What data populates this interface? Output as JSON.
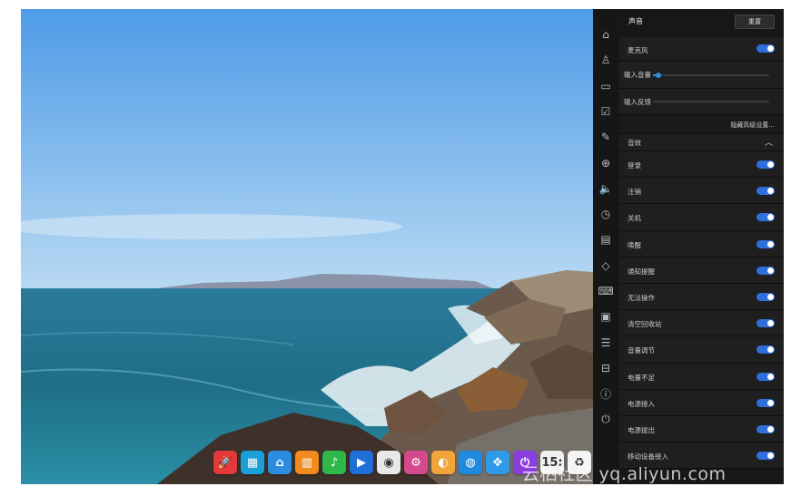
{
  "control_center": {
    "title": "声音",
    "reset_label": "重置",
    "microphone": {
      "label": "麦克风",
      "enabled": true
    },
    "input_volume": {
      "label": "输入音量",
      "level": 0.05
    },
    "input_feedback": {
      "label": "输入反馈",
      "level": 0.0
    },
    "advanced_link": "隐藏高级设置...",
    "effects_section": {
      "label": "音效",
      "expanded": true
    },
    "effects": [
      {
        "label": "登录",
        "enabled": true
      },
      {
        "label": "注销",
        "enabled": true
      },
      {
        "label": "关机",
        "enabled": true
      },
      {
        "label": "唤醒",
        "enabled": true
      },
      {
        "label": "通知提醒",
        "enabled": true
      },
      {
        "label": "无法操作",
        "enabled": true
      },
      {
        "label": "清空回收站",
        "enabled": true
      },
      {
        "label": "音量调节",
        "enabled": true
      },
      {
        "label": "电量不足",
        "enabled": true
      },
      {
        "label": "电源接入",
        "enabled": true
      },
      {
        "label": "电源拔出",
        "enabled": true
      },
      {
        "label": "移动设备接入",
        "enabled": true
      }
    ],
    "nav_icons": [
      "home-icon",
      "account-icon",
      "display-icon",
      "default-apps-icon",
      "personalization-icon",
      "network-icon",
      "sound-icon",
      "time-icon",
      "power-icon",
      "mouse-icon",
      "keyboard-icon",
      "update-icon",
      "system-info-icon",
      "more-icon",
      "info-icon",
      "shutdown-icon"
    ],
    "accent_color": "#2f6fdc"
  },
  "dock": {
    "apps": [
      {
        "icon": "launcher-icon",
        "color": "#e23a3a",
        "glyph": "🚀"
      },
      {
        "icon": "multitasking-icon",
        "color": "#1aa0d8",
        "glyph": "▦"
      },
      {
        "icon": "file-manager-icon",
        "color": "#2a8de0",
        "glyph": "⌂"
      },
      {
        "icon": "app-store-icon",
        "color": "#f28a1e",
        "glyph": "▥"
      },
      {
        "icon": "music-icon",
        "color": "#2fb84a",
        "glyph": "♪"
      },
      {
        "icon": "video-player-icon",
        "color": "#1e6fd8",
        "glyph": "▶"
      },
      {
        "icon": "chrome-icon",
        "color": "#e8e8e8",
        "glyph": "◉"
      },
      {
        "icon": "settings-icon",
        "color": "#d44a8c",
        "glyph": "⚙"
      },
      {
        "icon": "deepin-icon",
        "color": "#f2a53a",
        "glyph": "◐"
      },
      {
        "icon": "browser-icon",
        "color": "#1f8be0",
        "glyph": "◍"
      },
      {
        "icon": "app-grid-icon",
        "color": "#2f9ae8",
        "glyph": "✥"
      },
      {
        "icon": "power-icon",
        "color": "#8b3ee0",
        "glyph": "⏻"
      },
      {
        "icon": "clock-icon",
        "color": "#f0f0f0",
        "glyph": "15:"
      },
      {
        "icon": "trash-icon",
        "color": "#f4f4f4",
        "glyph": "♻"
      }
    ]
  },
  "watermark": "云栖社区 yq.aliyun.com"
}
